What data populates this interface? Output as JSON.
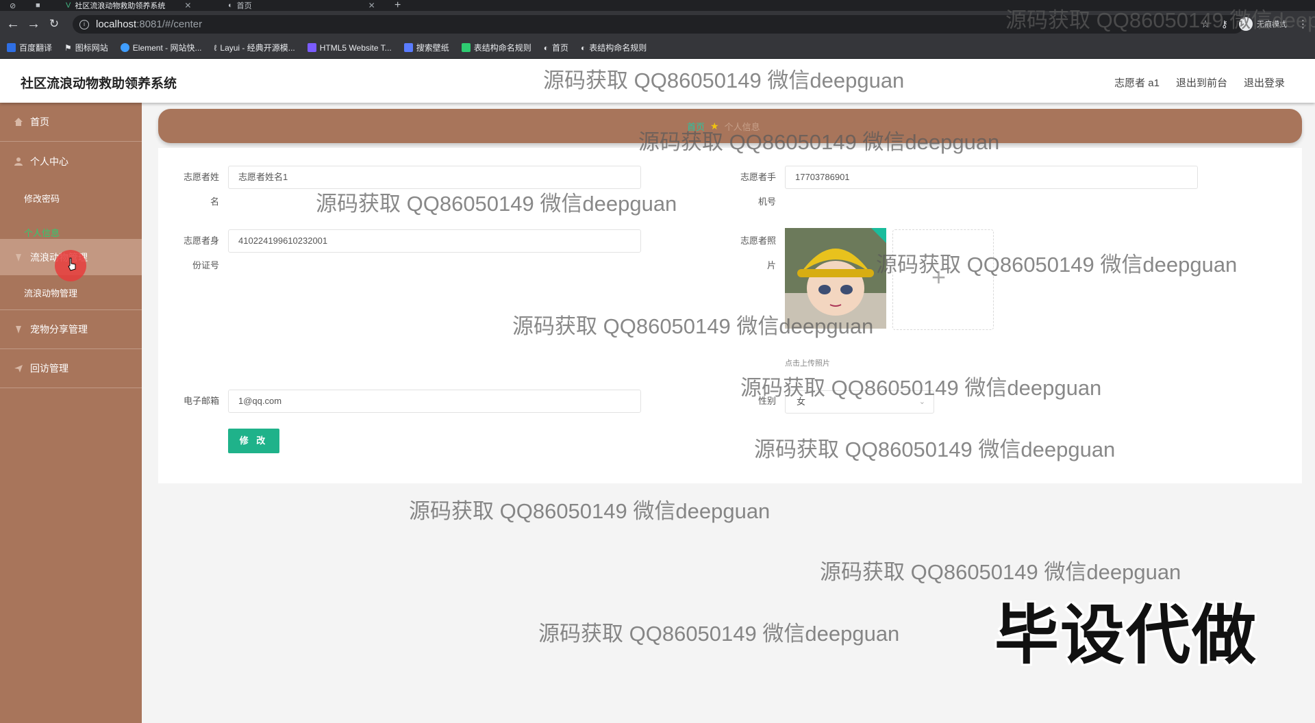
{
  "browser": {
    "tabs": [
      {
        "title": "社区流浪动物救助领养系统",
        "active": true
      },
      {
        "title": "首页",
        "active": false
      }
    ],
    "url_host": "localhost",
    "url_path": ":8081/#/center",
    "incognito_label": "无痕模式",
    "bookmarks": [
      {
        "label": "百度翻译",
        "icon": "baidu-translate-icon",
        "color": "#2f6fe4"
      },
      {
        "label": "图标网站",
        "icon": "flag-icon",
        "color": "#ffffff"
      },
      {
        "label": "Element - 网站快...",
        "icon": "element-icon",
        "color": "#409eff"
      },
      {
        "label": "Layui - 经典开源模...",
        "icon": "layui-icon",
        "color": "#aaaaaa"
      },
      {
        "label": "HTML5 Website T...",
        "icon": "html5-icon",
        "color": "#7b5cff"
      },
      {
        "label": "搜索壁纸",
        "icon": "wallpaper-icon",
        "color": "#5a7cff"
      },
      {
        "label": "表结构命名规则",
        "icon": "table-icon",
        "color": "#2ecc71"
      },
      {
        "label": "首页",
        "icon": "globe-icon",
        "color": "#dddddd"
      },
      {
        "label": "表结构命名规则",
        "icon": "globe-icon",
        "color": "#dddddd"
      }
    ]
  },
  "header": {
    "title": "社区流浪动物救助领养系统",
    "user": "志愿者 a1",
    "front_link": "退出到前台",
    "logout_link": "退出登录"
  },
  "sidebar": {
    "home": "首页",
    "personal_center": "个人中心",
    "change_password": "修改密码",
    "personal_info": "个人信息",
    "stray_group": "流浪动物管理",
    "stray_manage": "流浪动物管理",
    "pet_share": "宠物分享管理",
    "visit": "回访管理"
  },
  "breadcrumb": {
    "home": "首页",
    "current": "个人信息"
  },
  "form": {
    "name_label": "志愿者姓名",
    "name_value": "志愿者姓名1",
    "phone_label": "志愿者手机号",
    "phone_value": "17703786901",
    "idcard_label": "志愿者身份证号",
    "idcard_value": "410224199610232001",
    "photo_label": "志愿者照片",
    "upload_hint": "点击上传照片",
    "email_label": "电子邮箱",
    "email_value": "1@qq.com",
    "gender_label": "性别",
    "gender_value": "女",
    "submit": "修 改"
  },
  "watermark": {
    "text": "源码获取 QQ86050149 微信deepguan",
    "big_text": "毕设代做"
  },
  "colors": {
    "sidebar": "#a8755b",
    "accent": "#1fb28a"
  }
}
